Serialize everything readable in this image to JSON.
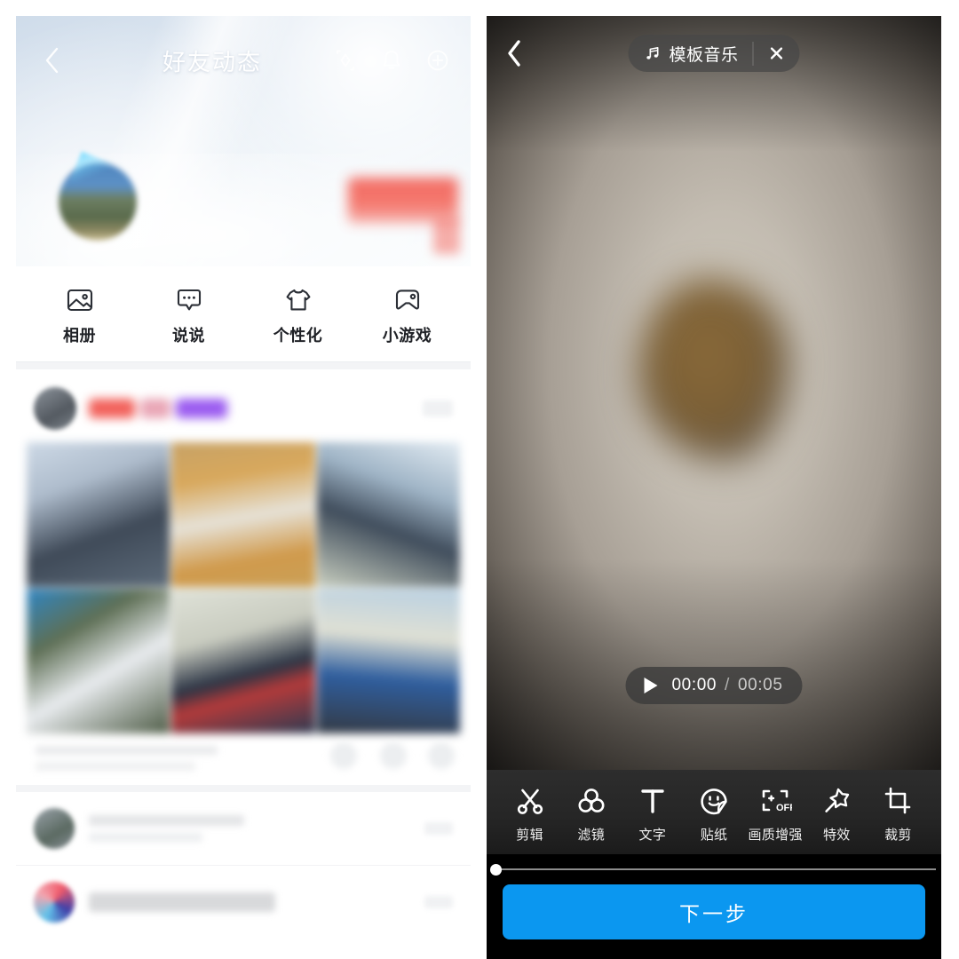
{
  "left_panel": {
    "header": {
      "back_icon": "chevron-left-icon",
      "title": "好友动态",
      "actions": [
        {
          "icon": "sparkle-diamond-icon",
          "name": "qzone-decorate-button"
        },
        {
          "icon": "bell-icon",
          "name": "qzone-notifications-button"
        },
        {
          "icon": "plus-circle-icon",
          "name": "qzone-publish-button"
        }
      ]
    },
    "nav": [
      {
        "icon": "photo-icon",
        "label": "相册"
      },
      {
        "icon": "speech-bubble-icon",
        "label": "说说"
      },
      {
        "icon": "tshirt-icon",
        "label": "个性化"
      },
      {
        "icon": "gamepad-icon",
        "label": "小游戏"
      }
    ],
    "feed": {
      "photo_grid_count": 6,
      "rows": 2,
      "columns": 3
    }
  },
  "right_panel": {
    "header": {
      "back_icon": "chevron-left-icon",
      "music_icon": "music-note-icon",
      "music_label": "模板音乐",
      "close_icon": "close-icon"
    },
    "player": {
      "play_icon": "play-icon",
      "current_time": "00:00",
      "separator": "/",
      "duration": "00:05"
    },
    "tools": [
      {
        "icon": "scissors-icon",
        "label": "剪辑"
      },
      {
        "icon": "filter-circles-icon",
        "label": "滤镜"
      },
      {
        "icon": "text-t-icon",
        "label": "文字"
      },
      {
        "icon": "sticker-face-icon",
        "label": "贴纸"
      },
      {
        "icon": "enhance-off-icon",
        "label": "画质增强"
      },
      {
        "icon": "magic-star-icon",
        "label": "特效"
      },
      {
        "icon": "crop-icon",
        "label": "裁剪"
      }
    ],
    "next_button": "下一步",
    "colors": {
      "accent_blue": "#0b97f0",
      "panel_black": "#000000"
    }
  }
}
